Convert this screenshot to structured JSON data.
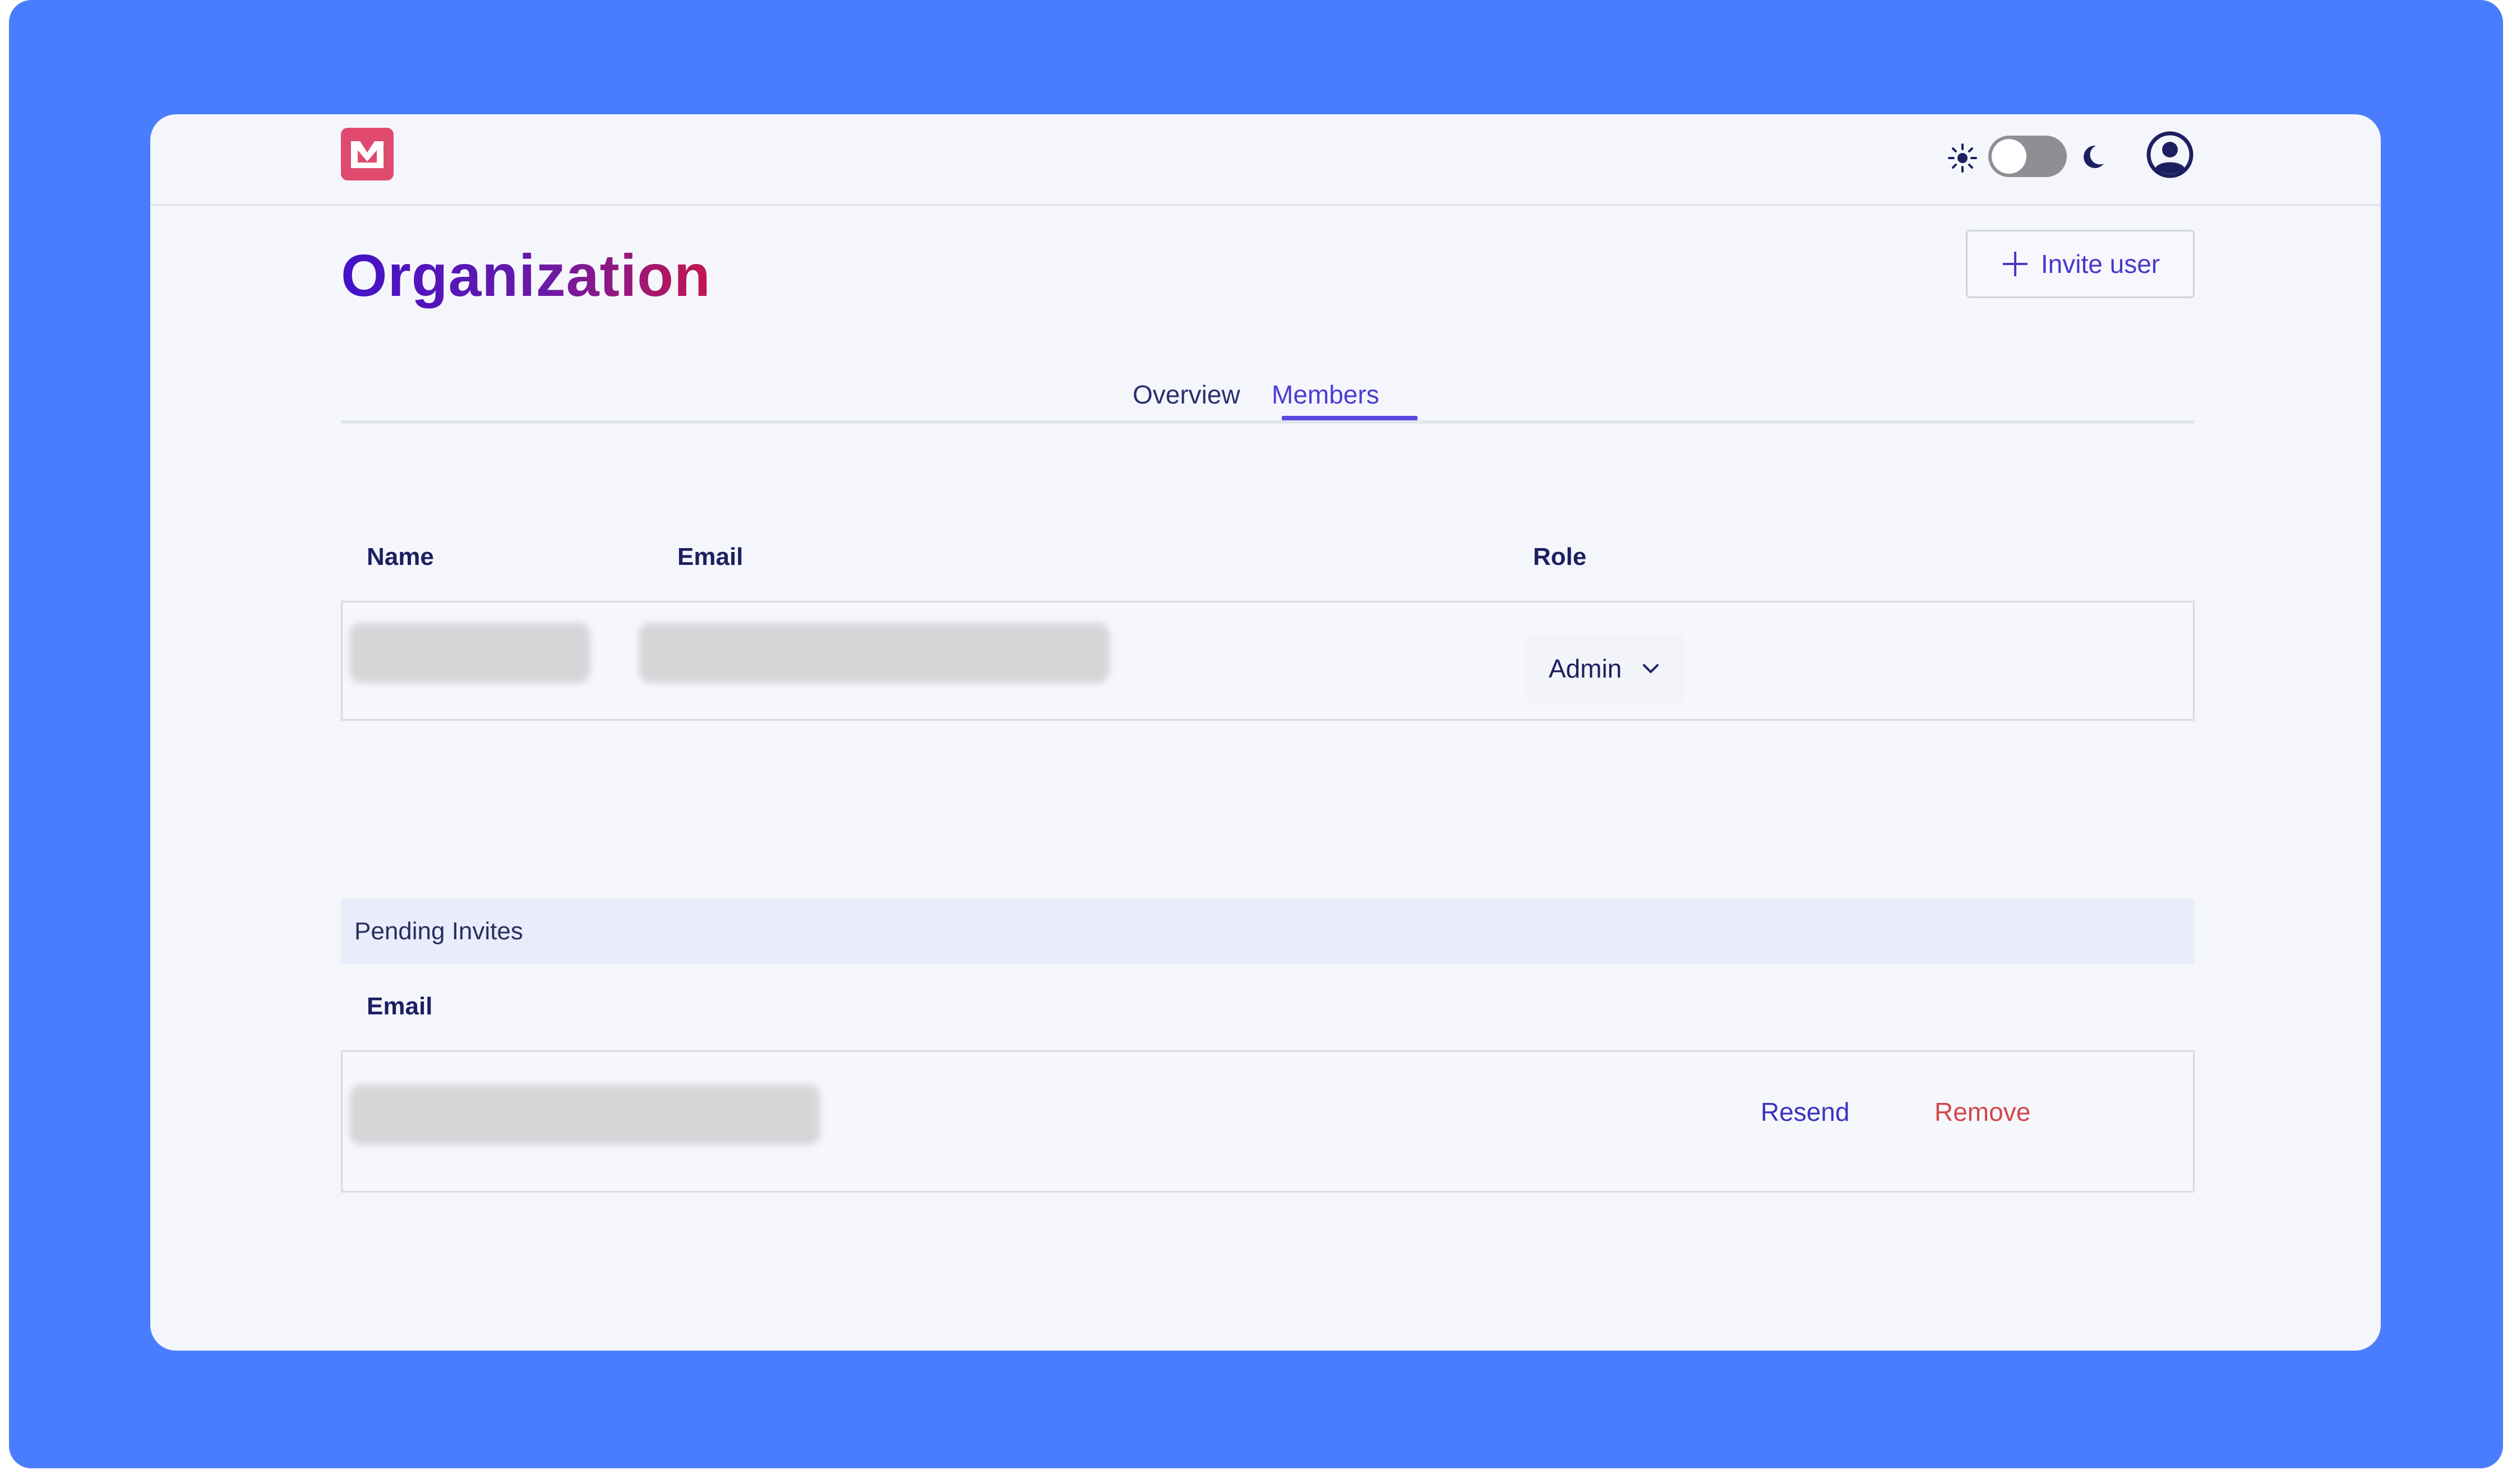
{
  "page": {
    "title": "Organization",
    "invite_button_label": "Invite user"
  },
  "tabs": [
    {
      "label": "Overview",
      "active": false
    },
    {
      "label": "Members",
      "active": true
    }
  ],
  "members_table": {
    "headers": [
      "Name",
      "Email",
      "Role"
    ],
    "rows": [
      {
        "name": "",
        "email": "",
        "role": "Admin"
      }
    ]
  },
  "pending_invites": {
    "title": "Pending Invites",
    "headers": [
      "Email"
    ],
    "rows": [
      {
        "email": "",
        "resend_label": "Resend",
        "remove_label": "Remove"
      }
    ]
  },
  "header": {
    "theme_toggle_state": "light",
    "icons": [
      "brand-logo-icon",
      "sun-icon",
      "moon-icon",
      "user-avatar-icon"
    ]
  },
  "colors": {
    "outer_background": "#4a7dfe",
    "window_background": "#f5f6fc",
    "accent": "#4e3ad6",
    "title_gradient_start": "#4212c9",
    "title_gradient_end": "#c5164e",
    "logo": "#e04a6f",
    "danger": "#d2474c"
  }
}
